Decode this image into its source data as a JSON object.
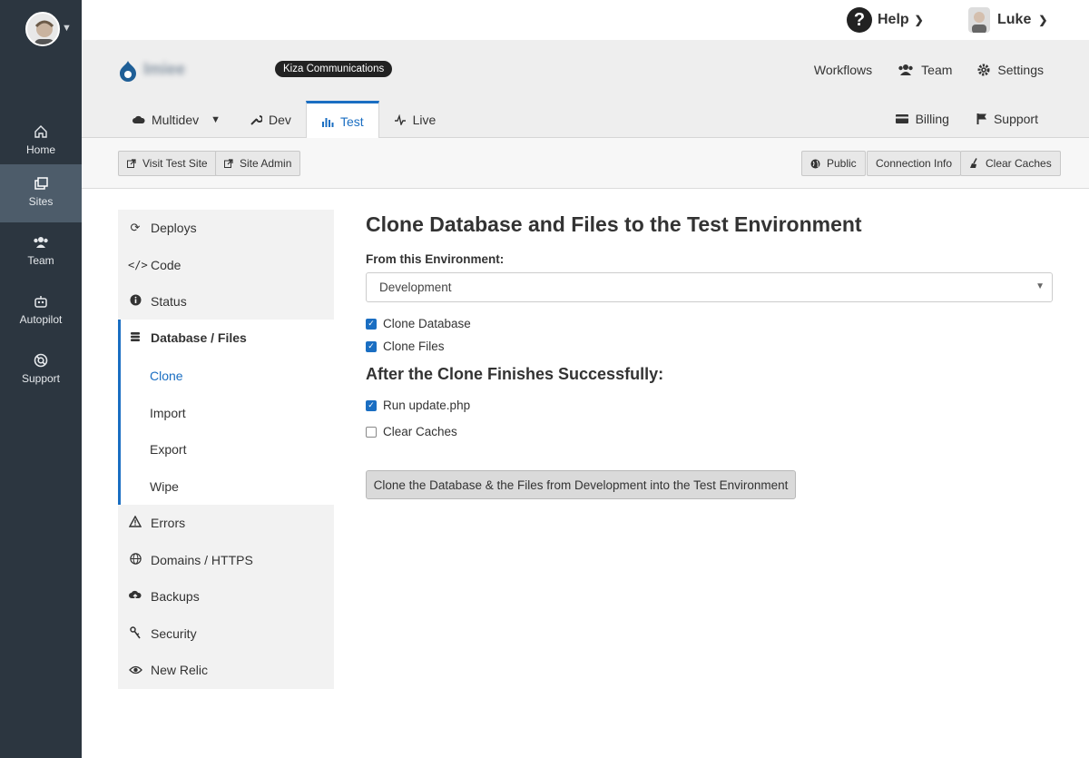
{
  "rail": {
    "items": [
      {
        "label": "Home",
        "icon": "home-icon"
      },
      {
        "label": "Sites",
        "icon": "sites-icon"
      },
      {
        "label": "Team",
        "icon": "team-icon"
      },
      {
        "label": "Autopilot",
        "icon": "robot-icon"
      },
      {
        "label": "Support",
        "icon": "lifebuoy-icon"
      }
    ]
  },
  "topbar": {
    "help_label": "Help",
    "user_name": "Luke"
  },
  "site": {
    "name": "Imiee",
    "org_badge": "Kiza Communications",
    "links": {
      "workflows": "Workflows",
      "team": "Team",
      "settings": "Settings"
    },
    "tabs": [
      {
        "label": "Multidev"
      },
      {
        "label": "Dev"
      },
      {
        "label": "Test"
      },
      {
        "label": "Live"
      }
    ],
    "right_links": {
      "billing": "Billing",
      "support": "Support"
    }
  },
  "toolbar": {
    "visit_site": "Visit Test Site",
    "site_admin": "Site Admin",
    "public": "Public",
    "connection_info": "Connection Info",
    "clear_caches": "Clear Caches"
  },
  "sidemenu": {
    "deploys": "Deploys",
    "code": "Code",
    "status": "Status",
    "database_files": "Database / Files",
    "sub": {
      "clone": "Clone",
      "import": "Import",
      "export": "Export",
      "wipe": "Wipe"
    },
    "errors": "Errors",
    "domains": "Domains / HTTPS",
    "backups": "Backups",
    "security": "Security",
    "new_relic": "New Relic"
  },
  "main": {
    "title": "Clone Database and Files to the Test Environment",
    "from_label": "From this Environment:",
    "from_value": "Development",
    "clone_database": "Clone Database",
    "clone_files": "Clone Files",
    "after_title": "After the Clone Finishes Successfully:",
    "run_update": "Run update.php",
    "clear_caches": "Clear Caches",
    "submit": "Clone the Database & the Files from Development into the Test Environment"
  },
  "colors": {
    "accent": "#1a6ec2",
    "rail": "#2c3640"
  }
}
